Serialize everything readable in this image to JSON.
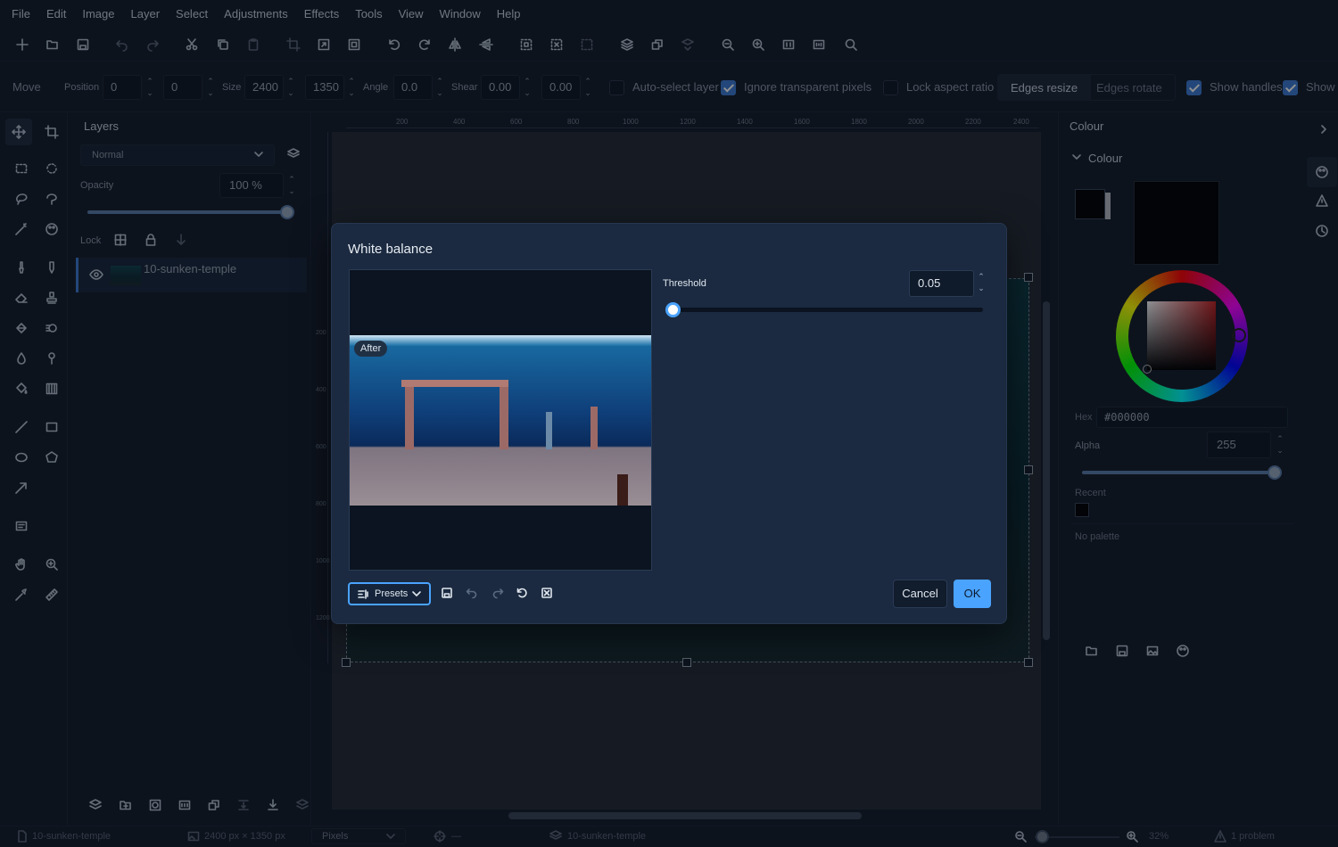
{
  "menu": [
    "File",
    "Edit",
    "Image",
    "Layer",
    "Select",
    "Adjustments",
    "Effects",
    "Tools",
    "View",
    "Window",
    "Help"
  ],
  "options": {
    "tool_name": "Move",
    "position_label": "Position",
    "position_x": "0",
    "position_y": "0",
    "size_label": "Size",
    "size_w": "2400",
    "size_h": "1350",
    "angle_label": "Angle",
    "angle": "0.0",
    "shear_label": "Shear",
    "shear_x": "0.00",
    "shear_y": "0.00",
    "auto_select": "Auto-select layer",
    "ignore_transparent": "Ignore transparent pixels",
    "lock_aspect": "Lock aspect ratio",
    "edges_resize": "Edges resize",
    "edges_rotate": "Edges rotate",
    "show_handles": "Show handles",
    "show_more": "Show"
  },
  "layers": {
    "title": "Layers",
    "blend_mode": "Normal",
    "opacity_label": "Opacity",
    "opacity_value": "100 %",
    "opacity_level": 1.0,
    "lock_label": "Lock",
    "items": [
      {
        "name": "10-sunken-temple",
        "visible": true
      }
    ]
  },
  "ruler": {
    "top_ticks": [
      "200",
      "400",
      "600",
      "800",
      "1000",
      "1200",
      "1400",
      "1600",
      "1800",
      "2000",
      "2200",
      "2400"
    ],
    "left_ticks": [
      "200",
      "400",
      "600",
      "800",
      "1000",
      "1200"
    ]
  },
  "colour_panel": {
    "title": "Colour",
    "section": "Colour",
    "hex_label": "Hex",
    "hex_value": "#000000",
    "alpha_label": "Alpha",
    "alpha_value": "255",
    "alpha_level": 1.0,
    "recent_label": "Recent",
    "palette_label": "No palette"
  },
  "dialog": {
    "title": "White balance",
    "preview_badge": "After",
    "threshold_label": "Threshold",
    "threshold_value": "0.05",
    "threshold_level": 0.0,
    "presets_label": "Presets",
    "cancel_label": "Cancel",
    "ok_label": "OK"
  },
  "status": {
    "document": "10-sunken-temple",
    "dimensions": "2400 px × 1350 px",
    "units": "Pixels",
    "cursor": "—",
    "layer": "10-sunken-temple",
    "zoom": "32%",
    "problems": "1 problem"
  },
  "colors": {
    "accent": "#4aa3ff",
    "panel": "#141c29",
    "dialog": "#1b2a40"
  }
}
